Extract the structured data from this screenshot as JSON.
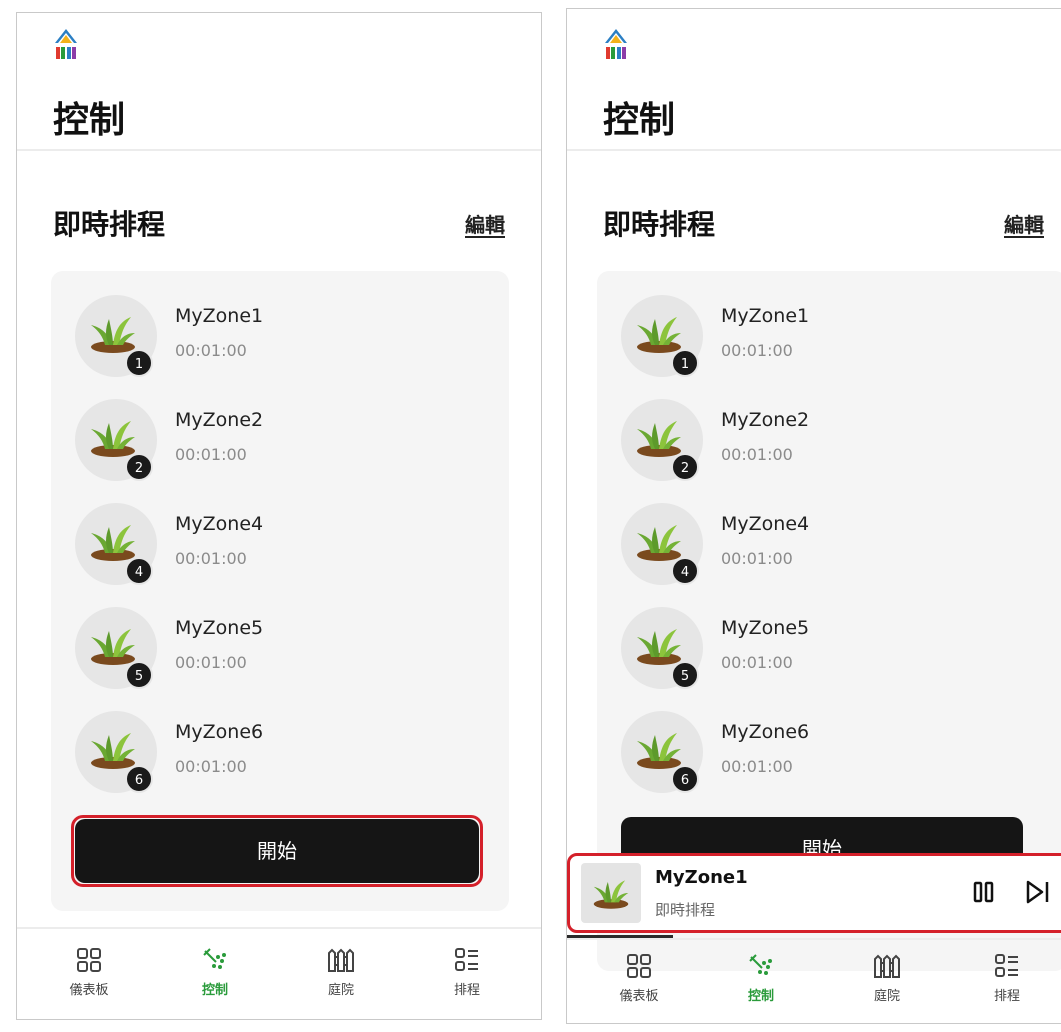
{
  "colors": {
    "accent_green": "#2a9b3b",
    "highlight_red": "#d4202a",
    "button_dark": "#151515"
  },
  "screen_a": {
    "title": "控制",
    "section_title": "即時排程",
    "edit_label": "編輯",
    "zones": [
      {
        "name": "MyZone1",
        "time": "00:01:00",
        "badge": "1"
      },
      {
        "name": "MyZone2",
        "time": "00:01:00",
        "badge": "2"
      },
      {
        "name": "MyZone4",
        "time": "00:01:00",
        "badge": "4"
      },
      {
        "name": "MyZone5",
        "time": "00:01:00",
        "badge": "5"
      },
      {
        "name": "MyZone6",
        "time": "00:01:00",
        "badge": "6"
      }
    ],
    "start_label": "開始",
    "nav": [
      {
        "label": "儀表板",
        "icon": "dashboard-icon"
      },
      {
        "label": "控制",
        "icon": "sprinkler-icon",
        "active": true
      },
      {
        "label": "庭院",
        "icon": "fence-icon"
      },
      {
        "label": "排程",
        "icon": "schedule-list-icon"
      }
    ]
  },
  "screen_b": {
    "title": "控制",
    "section_title": "即時排程",
    "edit_label": "編輯",
    "zones": [
      {
        "name": "MyZone1",
        "time": "00:01:00",
        "badge": "1"
      },
      {
        "name": "MyZone2",
        "time": "00:01:00",
        "badge": "2"
      },
      {
        "name": "MyZone4",
        "time": "00:01:00",
        "badge": "4"
      },
      {
        "name": "MyZone5",
        "time": "00:01:00",
        "badge": "5"
      },
      {
        "name": "MyZone6",
        "time": "00:01:00",
        "badge": "6"
      }
    ],
    "start_label": "開始",
    "mini_player": {
      "title": "MyZone1",
      "subtitle": "即時排程",
      "pause_icon": "pause-icon",
      "skip_icon": "skip-next-icon"
    },
    "nav": [
      {
        "label": "儀表板",
        "icon": "dashboard-icon"
      },
      {
        "label": "控制",
        "icon": "sprinkler-icon",
        "active": true
      },
      {
        "label": "庭院",
        "icon": "fence-icon"
      },
      {
        "label": "排程",
        "icon": "schedule-list-icon"
      }
    ]
  }
}
